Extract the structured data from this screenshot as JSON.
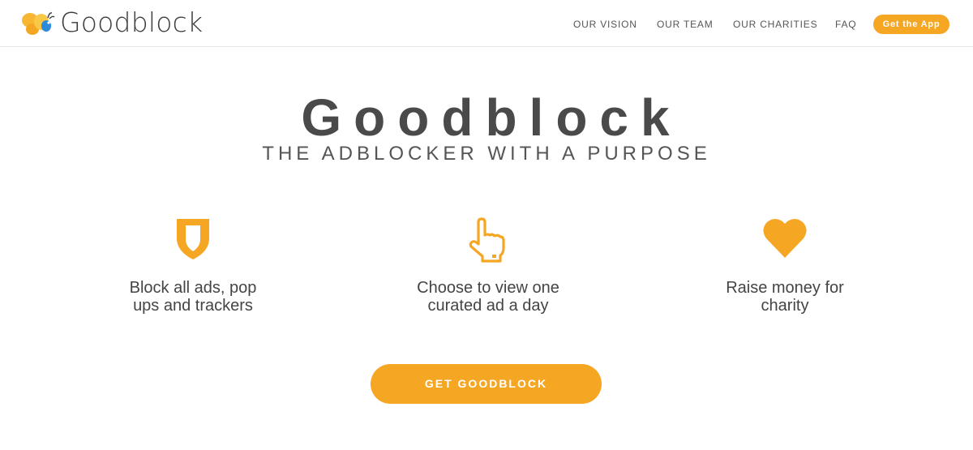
{
  "header": {
    "logo_text": "Goodblock",
    "nav": [
      "OUR VISION",
      "OUR TEAM",
      "OUR CHARITIES",
      "FAQ"
    ],
    "cta_label": "Get the App"
  },
  "hero": {
    "title": "Goodblock",
    "subtitle": "THE ADBLOCKER WITH A PURPOSE"
  },
  "features": [
    {
      "icon": "shield-icon",
      "label": "Block all ads, pop\nups and trackers"
    },
    {
      "icon": "pointing-hand-icon",
      "label": "Choose to view one\ncurated ad a day"
    },
    {
      "icon": "heart-icon",
      "label": "Raise money for\ncharity"
    }
  ],
  "cta": {
    "label": "GET GOODBLOCK"
  },
  "colors": {
    "accent": "#f5a623",
    "text": "#444444",
    "logo_blue": "#2e8bd8"
  }
}
